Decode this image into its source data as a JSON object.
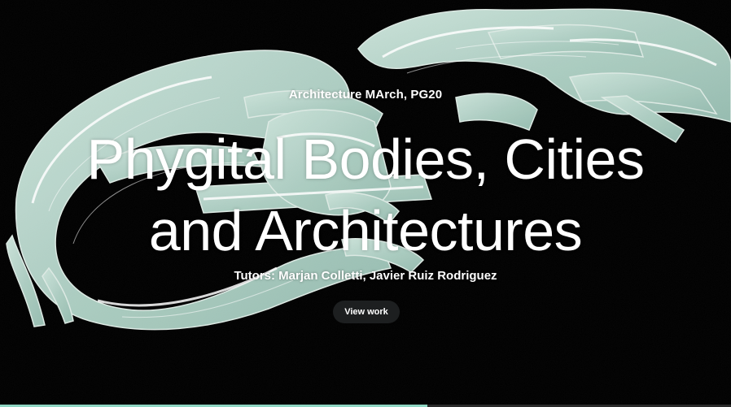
{
  "hero": {
    "kicker": "Architecture MArch, PG20",
    "title_line1": "Phygital Bodies, Cities",
    "title_line2": "and Architectures",
    "tutors": "Tutors: Marjan Colletti, Javier Ruiz Rodriguez",
    "cta_label": "View work",
    "background_description_color": "#cfe9e0",
    "progress": 0.585
  },
  "colors": {
    "background": "#000000",
    "text": "#ffffff",
    "button_bg": "#1d1f20",
    "art_tint": "#cfe9e0",
    "progress_accent": "#8fd6c3"
  }
}
